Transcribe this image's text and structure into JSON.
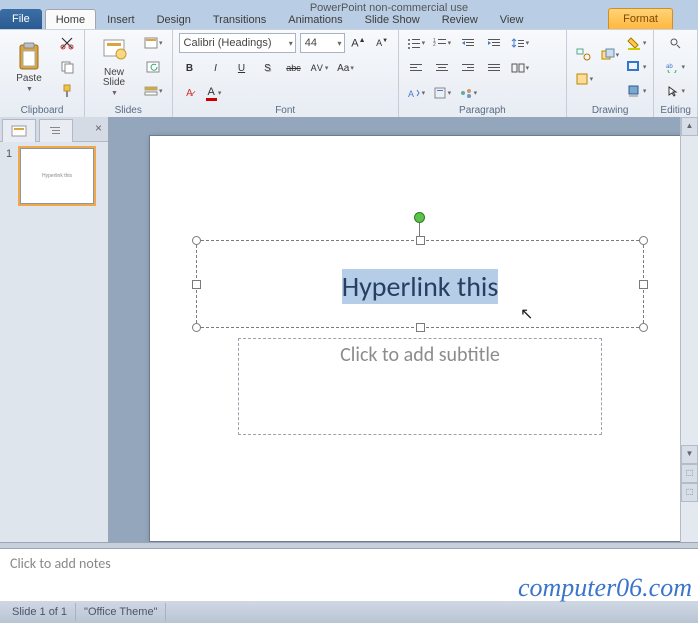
{
  "titlebar": {
    "fragment": "PowerPoint non-commercial use"
  },
  "tabs": {
    "file": "File",
    "items": [
      "Home",
      "Insert",
      "Design",
      "Transitions",
      "Animations",
      "Slide Show",
      "Review",
      "View"
    ],
    "active": 0,
    "contextual": "Format"
  },
  "ribbon": {
    "clipboard": {
      "label": "Clipboard",
      "paste": "Paste"
    },
    "slides": {
      "label": "Slides",
      "newslide": "New\nSlide"
    },
    "font": {
      "label": "Font",
      "name": "Calibri (Headings)",
      "size": "44",
      "bold": "B",
      "italic": "I",
      "underline": "U",
      "strike": "abc",
      "shadow": "S"
    },
    "paragraph": {
      "label": "Paragraph"
    },
    "drawing": {
      "label": "Drawing"
    },
    "editing": {
      "label": "Editing"
    }
  },
  "thumbnails": {
    "slides": [
      {
        "num": "1",
        "preview": "Hyperlink this"
      }
    ]
  },
  "slide": {
    "title": "Hyperlink this",
    "subtitle_placeholder": "Click to add subtitle"
  },
  "notes": {
    "placeholder": "Click to add notes"
  },
  "status": {
    "slide": "Slide 1 of 1",
    "theme": "\"Office Theme\""
  },
  "watermark": "computer06.com"
}
